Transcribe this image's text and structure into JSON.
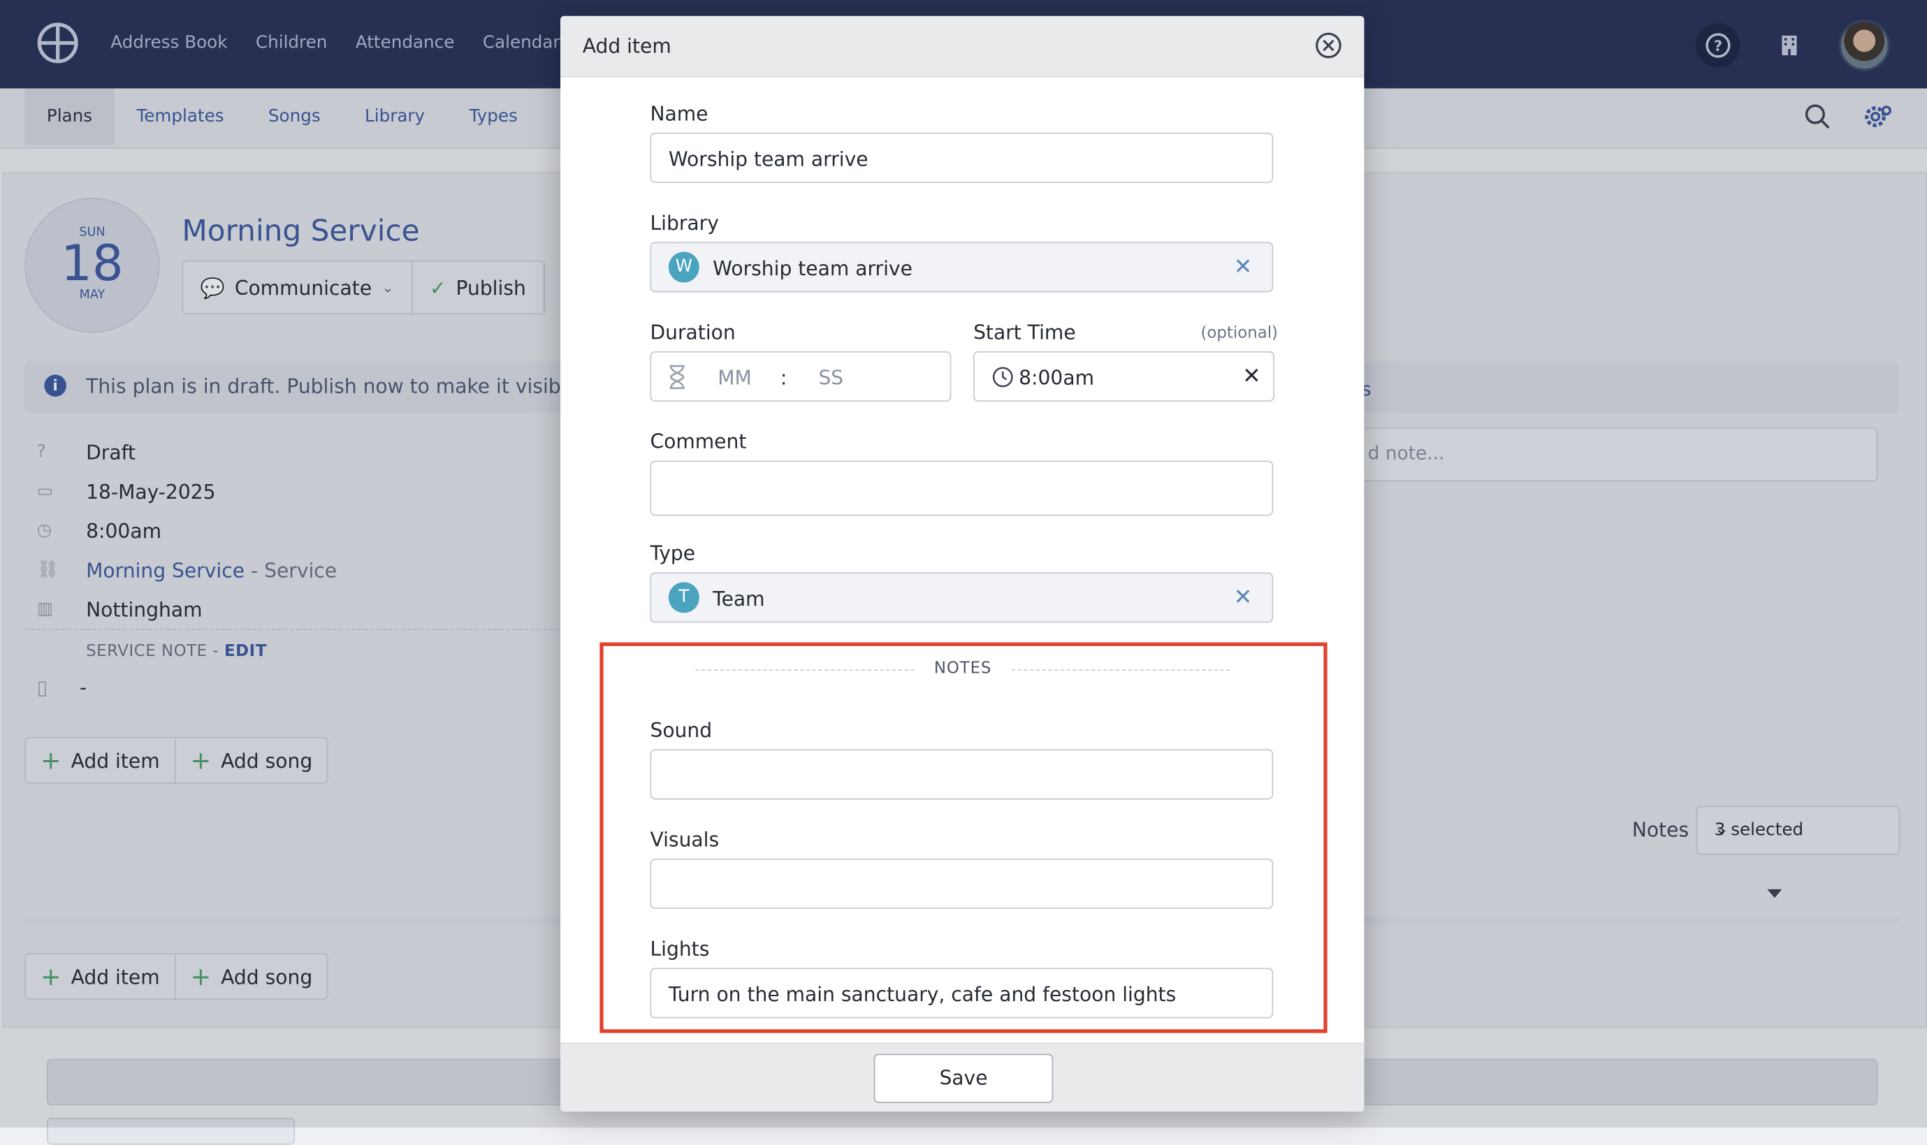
{
  "topnav": {
    "items": [
      "Address Book",
      "Children",
      "Attendance",
      "Calendar"
    ]
  },
  "subnav": {
    "items": [
      "Plans",
      "Templates",
      "Songs",
      "Library",
      "Types"
    ]
  },
  "plan": {
    "date": {
      "dow": "SUN",
      "day": "18",
      "month": "MAY"
    },
    "title": "Morning Service",
    "actions": {
      "communicate": "Communicate",
      "publish": "Publish"
    },
    "draft_banner": "This plan is in draft. Publish now to make it visible in",
    "details": {
      "status": "Draft",
      "date": "18-May-2025",
      "time": "8:00am",
      "service_link": "Morning Service",
      "service_suffix": "- Service",
      "location": "Nottingham"
    },
    "service_note_label": "SERVICE NOTE -",
    "service_note_edit": "EDIT",
    "service_note_value": "-",
    "add_item": "Add item",
    "add_song": "Add song"
  },
  "side": {
    "note_heading_fragment": "s",
    "note_placeholder_fragment": "d note...",
    "notes_label": "Notes",
    "notes_select": "3 selected"
  },
  "modal": {
    "title": "Add item",
    "name_label": "Name",
    "name_value": "Worship team arrive",
    "library_label": "Library",
    "library_chip": "W",
    "library_value": "Worship team arrive",
    "duration_label": "Duration",
    "duration_mm": "MM",
    "duration_colon": ":",
    "duration_ss": "SS",
    "start_time_label": "Start Time",
    "start_time_optional": "(optional)",
    "start_time_value": "8:00am",
    "comment_label": "Comment",
    "comment_value": "",
    "type_label": "Type",
    "type_chip": "T",
    "type_value": "Team",
    "notes_heading": "NOTES",
    "sound_label": "Sound",
    "sound_value": "",
    "visuals_label": "Visuals",
    "visuals_value": "",
    "lights_label": "Lights",
    "lights_value": "Turn on the main sanctuary, cafe and festoon lights",
    "save_label": "Save",
    "close_glyph": "×",
    "clear_glyph": "✕"
  },
  "colors": {
    "topbar": "#273056",
    "link": "#3d5aa1",
    "highlight": "#e2412d",
    "chip": "#4aa3bf"
  }
}
